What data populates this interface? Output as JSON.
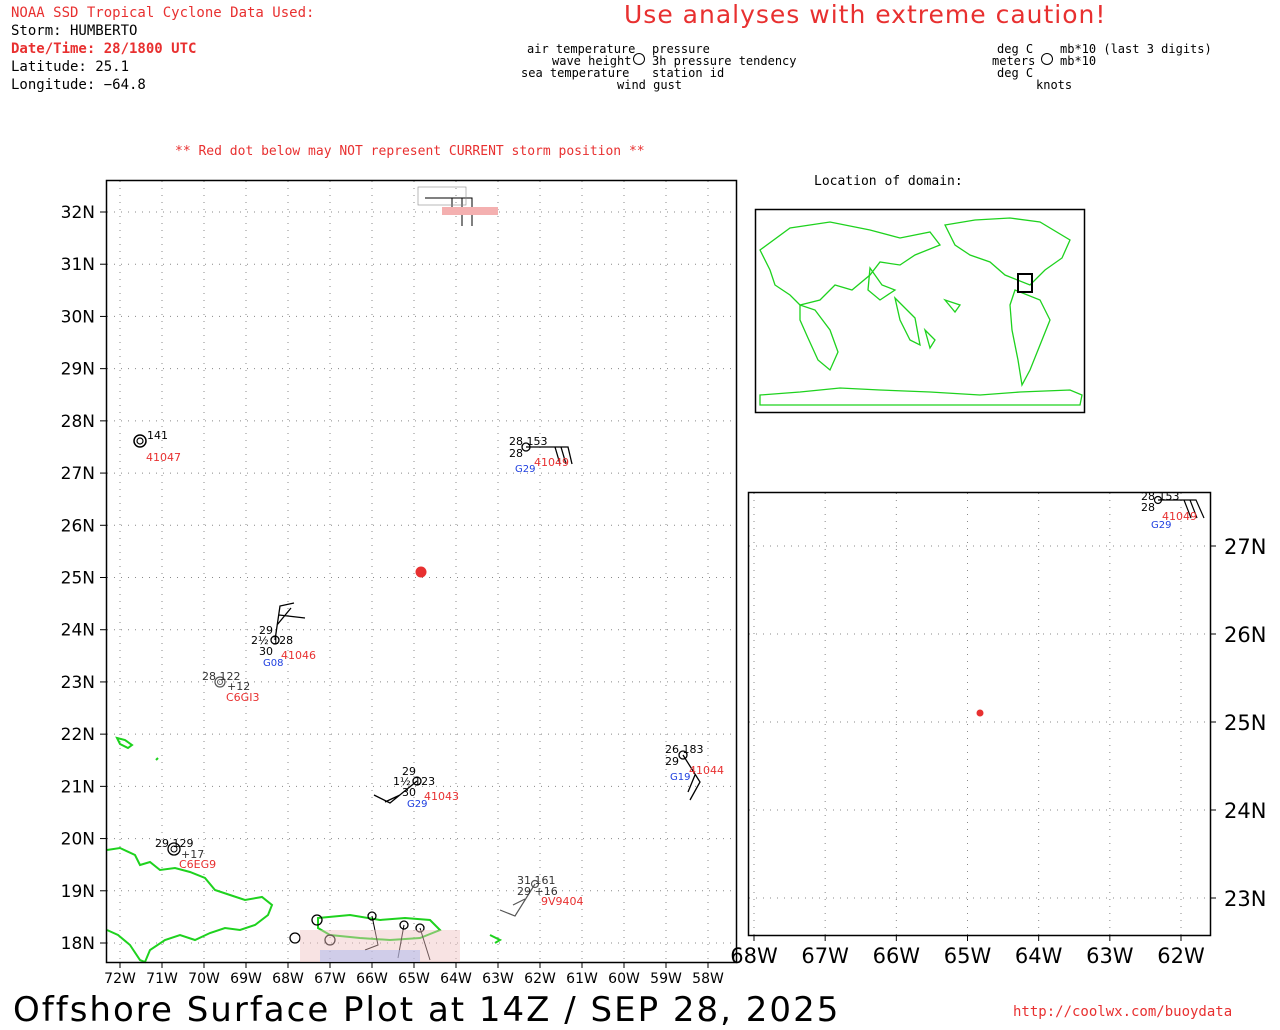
{
  "header": {
    "source": "NOAA SSD Tropical Cyclone Data Used:",
    "storm": "Storm: HUMBERTO",
    "datetime": "Date/Time: 28/1800 UTC",
    "latitude": "Latitude: 25.1",
    "longitude": "Longitude: −64.8",
    "caution": "Use analyses with extreme caution!"
  },
  "legend": {
    "left_top_left": "air temperature",
    "left_top_right": "pressure",
    "left_mid_left": "wave height",
    "left_mid_right": "3h pressure tendency",
    "left_bot_left": "sea temperature",
    "left_bot_right": "station id",
    "left_gust": "wind gust",
    "units_top_left": "deg C",
    "units_top_right": "mb*10 (last 3 digits)",
    "units_mid_left": "meters",
    "units_mid_right": "mb*10",
    "units_bot_left": "deg C",
    "units_gust": "knots"
  },
  "warning": "** Red dot below may NOT represent CURRENT storm position **",
  "inset_title": "Location of domain:",
  "main_map": {
    "lat_labels": [
      "32N",
      "31N",
      "30N",
      "29N",
      "28N",
      "27N",
      "26N",
      "25N",
      "24N",
      "23N",
      "22N",
      "21N",
      "20N",
      "19N",
      "18N"
    ],
    "lon_labels": [
      "72W",
      "71W",
      "70W",
      "69W",
      "68W",
      "67W",
      "66W",
      "65W",
      "64W",
      "63W",
      "62W",
      "61W",
      "60W",
      "59W",
      "58W"
    ]
  },
  "zoom_map": {
    "lat_labels": [
      "27N",
      "26N",
      "25N",
      "24N",
      "23N"
    ],
    "lon_labels": [
      "68W",
      "67W",
      "66W",
      "65W",
      "64W",
      "63W",
      "62W"
    ]
  },
  "stations": [
    {
      "id": "41047",
      "lines": [
        "141"
      ]
    },
    {
      "id": "41049",
      "lines": [
        "28 153",
        "28"
      ],
      "g": "G29"
    },
    {
      "id": "41046",
      "lines": [
        "29",
        "2½ 128",
        "30"
      ],
      "g": "G08"
    },
    {
      "id": "C6GI3",
      "lines": [
        "28 122",
        "+12"
      ]
    },
    {
      "id": "41043",
      "lines": [
        "29",
        "1½ 123",
        "30"
      ],
      "g": "G29"
    },
    {
      "id": "41044",
      "lines": [
        "26 183",
        "29"
      ],
      "g": "G19"
    },
    {
      "id": "9V9404",
      "lines": [
        "31 161",
        "29 +16"
      ]
    },
    {
      "id": "C6EG9",
      "lines": [
        "29 129",
        "+17"
      ]
    }
  ],
  "storm_center": {
    "lat": 25.1,
    "lon": -64.8,
    "color": "#e83030"
  },
  "colors": {
    "coast": "#1ed21e",
    "station_id": "#e83030",
    "gust": "#2040e0",
    "grid": "#888888"
  },
  "footer": {
    "title": "Offshore Surface Plot at 14Z / SEP 28, 2025",
    "url": "http://coolwx.com/buoydata"
  }
}
